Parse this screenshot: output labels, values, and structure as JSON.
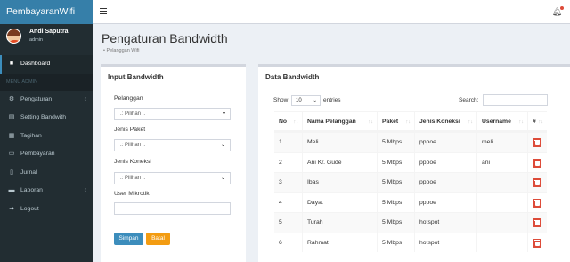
{
  "app": {
    "brand": "PembayaranWifi"
  },
  "user": {
    "name": "Andi Saputra",
    "role": "admin"
  },
  "sidebar": {
    "items_before": [
      {
        "label": "Dashboard",
        "icon": "dashboard-icon",
        "glyph": "■",
        "active": true
      }
    ],
    "menu_header": "MENU ADMIN",
    "items": [
      {
        "label": "Pengaturan",
        "icon": "gear-icon",
        "glyph": "⚙",
        "chevron": "‹"
      },
      {
        "label": "Setting Bandwith",
        "icon": "file-icon",
        "glyph": "▤"
      },
      {
        "label": "Tagihan",
        "icon": "invoice-icon",
        "glyph": "▦"
      },
      {
        "label": "Pembayaran",
        "icon": "money-icon",
        "glyph": "▭"
      },
      {
        "label": "Jurnal",
        "icon": "book-icon",
        "glyph": "▯"
      },
      {
        "label": "Laporan",
        "icon": "printer-icon",
        "glyph": "▬",
        "chevron": "‹"
      },
      {
        "label": "Logout",
        "icon": "logout-icon",
        "glyph": "➜"
      }
    ]
  },
  "page": {
    "title": "Pengaturan Bandwidth",
    "breadcrumb": "Pelanggan Wifi",
    "breadcrumb_icon": "•"
  },
  "form": {
    "title": "Input Bandwidth",
    "pelanggan_label": "Pelanggan",
    "pelanggan_value": ".: Pilihan :.",
    "paket_label": "Jenis Paket",
    "paket_value": ".: Pilihan :.",
    "koneksi_label": "Jenis Koneksi",
    "koneksi_value": ".: Pilihan :.",
    "mikrotik_label": "User Mikrotik",
    "mikrotik_value": "",
    "save_label": "Simpan",
    "cancel_label": "Batal"
  },
  "table": {
    "title": "Data Bandwidth",
    "show_label": "Show",
    "length_value": "10",
    "entries_label": "entries",
    "search_label": "Search:",
    "columns": [
      "No",
      "Nama Pelanggan",
      "Paket",
      "Jenis Koneksi",
      "Username",
      "#"
    ],
    "rows": [
      {
        "no": "1",
        "nama": "Meli",
        "paket": "5 Mbps",
        "jenis": "pppoe",
        "user": "meli"
      },
      {
        "no": "2",
        "nama": "Ani Kr. Gude",
        "paket": "5 Mbps",
        "jenis": "pppoe",
        "user": "ani"
      },
      {
        "no": "3",
        "nama": "Ibas",
        "paket": "5 Mbps",
        "jenis": "pppoe",
        "user": ""
      },
      {
        "no": "4",
        "nama": "Dayat",
        "paket": "5 Mbps",
        "jenis": "pppoe",
        "user": ""
      },
      {
        "no": "5",
        "nama": "Turah",
        "paket": "5 Mbps",
        "jenis": "hotspot",
        "user": ""
      },
      {
        "no": "6",
        "nama": "Rahmat",
        "paket": "5 Mbps",
        "jenis": "hotspot",
        "user": ""
      }
    ]
  },
  "colors": {
    "sidebar_bg": "#222d32",
    "brand_bg": "#367fa9",
    "primary": "#3c8dbc",
    "warning": "#f39c12",
    "danger": "#dd4b39"
  }
}
